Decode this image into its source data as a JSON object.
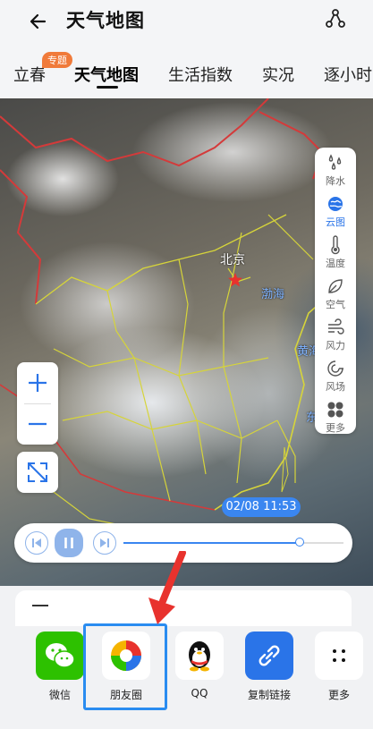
{
  "header": {
    "title": "天气地图",
    "back_icon": "back-arrow-icon",
    "share_icon": "share-nodes-icon"
  },
  "tabs": [
    {
      "label": "立春",
      "badge": "专题"
    },
    {
      "label": "天气地图",
      "active": true
    },
    {
      "label": "生活指数"
    },
    {
      "label": "实况"
    },
    {
      "label": "逐小时"
    }
  ],
  "map": {
    "city_label": "北京",
    "sea_label": "渤海",
    "sea_label_2": "黄海",
    "sea_label_3": "东"
  },
  "legend": [
    {
      "label": "降水",
      "icon": "rain-icon"
    },
    {
      "label": "云图",
      "icon": "cloud-globe-icon",
      "active": true
    },
    {
      "label": "温度",
      "icon": "thermometer-icon"
    },
    {
      "label": "空气",
      "icon": "leaf-icon"
    },
    {
      "label": "风力",
      "icon": "wind-icon"
    },
    {
      "label": "风场",
      "icon": "wind-field-icon"
    },
    {
      "label": "更多",
      "icon": "more-grid-icon"
    }
  ],
  "zoom": {
    "in": "+",
    "out": "−"
  },
  "player": {
    "time": "02/08 11:53",
    "progress": 0.8
  },
  "share_sheet": {
    "items": [
      {
        "label": "微信",
        "icon": "wechat-icon",
        "color": "#2dc100"
      },
      {
        "label": "朋友圈",
        "icon": "moments-icon",
        "color": "#ffffff"
      },
      {
        "label": "QQ",
        "icon": "qq-penguin-icon",
        "color": "#ffffff"
      },
      {
        "label": "复制链接",
        "icon": "link-icon",
        "color": "#2a74e8"
      },
      {
        "label": "更多",
        "icon": "more-dots-icon",
        "color": "#ffffff"
      }
    ]
  },
  "colors": {
    "accent": "#3a86f0",
    "highlight": "#2a8cf0",
    "arrow": "#e8322d",
    "badge": "#f07a3a"
  }
}
